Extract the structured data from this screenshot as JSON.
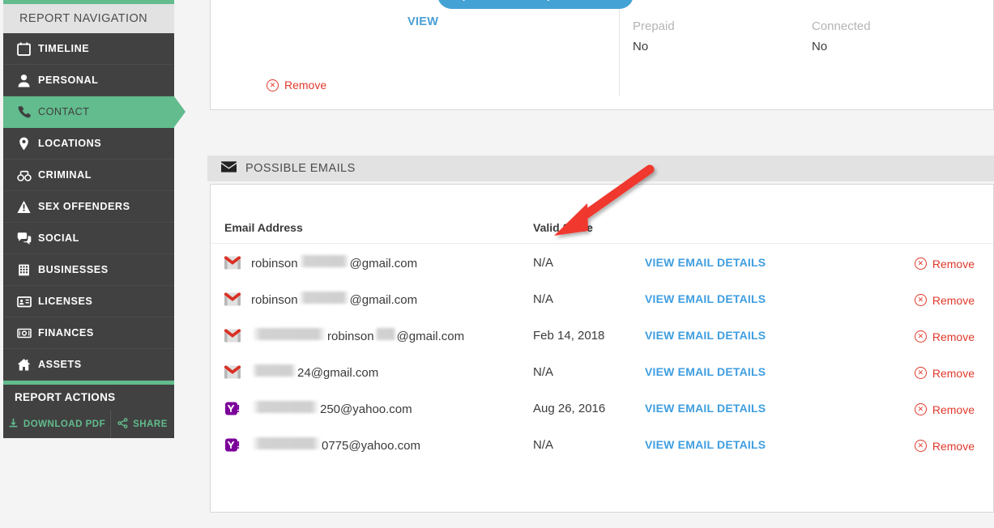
{
  "sidebar": {
    "header": "REPORT NAVIGATION",
    "items": [
      {
        "label": "TIMELINE",
        "icon": "calendar-icon",
        "active": false
      },
      {
        "label": "PERSONAL",
        "icon": "person-icon",
        "active": false
      },
      {
        "label": "CONTACT",
        "icon": "phone-icon",
        "active": true
      },
      {
        "label": "LOCATIONS",
        "icon": "map-pin-icon",
        "active": false
      },
      {
        "label": "CRIMINAL",
        "icon": "handcuffs-icon",
        "active": false
      },
      {
        "label": "SEX OFFENDERS",
        "icon": "warning-icon",
        "active": false
      },
      {
        "label": "SOCIAL",
        "icon": "chat-bubbles-icon",
        "active": false
      },
      {
        "label": "BUSINESSES",
        "icon": "building-icon",
        "active": false
      },
      {
        "label": "LICENSES",
        "icon": "id-card-icon",
        "active": false
      },
      {
        "label": "FINANCES",
        "icon": "banknote-icon",
        "active": false
      },
      {
        "label": "ASSETS",
        "icon": "house-icon",
        "active": false
      }
    ],
    "actions_header": "REPORT ACTIONS",
    "actions": [
      {
        "label": "DOWNLOAD PDF",
        "icon": "download-icon"
      },
      {
        "label": "SHARE",
        "icon": "share-icon"
      }
    ]
  },
  "top_panel": {
    "view_link": "VIEW",
    "tooltip": "Open or Close Report Sections",
    "fields": [
      {
        "label": "Prepaid",
        "value": "No"
      },
      {
        "label": "Connected",
        "value": "No"
      }
    ],
    "remove_label": "Remove"
  },
  "emails_section": {
    "header": "POSSIBLE EMAILS",
    "header_icon": "envelope-icon",
    "columns": {
      "email": "Email Address",
      "valid_since": "Valid Since",
      "details": "",
      "remove": ""
    },
    "details_label": "VIEW EMAIL DETAILS",
    "remove_label": "Remove",
    "rows": [
      {
        "provider": "gmail",
        "prefix": "robinson",
        "redact_w": 62,
        "middle": "",
        "redact2_w": 0,
        "suffix": "@gmail.com",
        "valid_since": "N/A"
      },
      {
        "provider": "gmail",
        "prefix": "robinson",
        "redact_w": 62,
        "middle": "",
        "redact2_w": 0,
        "suffix": "@gmail.com",
        "valid_since": "N/A"
      },
      {
        "provider": "gmail",
        "prefix": "",
        "redact_w": 92,
        "middle": "robinson",
        "redact2_w": 26,
        "suffix": "@gmail.com",
        "valid_since": "Feb 14, 2018"
      },
      {
        "provider": "gmail",
        "prefix": "",
        "redact_w": 55,
        "middle": "24",
        "redact2_w": 0,
        "suffix": "@gmail.com",
        "valid_since": "N/A"
      },
      {
        "provider": "yahoo",
        "prefix": "",
        "redact_w": 83,
        "middle": "250",
        "redact2_w": 0,
        "suffix": "@yahoo.com",
        "valid_since": "Aug 26, 2016"
      },
      {
        "provider": "yahoo",
        "prefix": "",
        "redact_w": 85,
        "middle": "0775",
        "redact2_w": 0,
        "suffix": "@yahoo.com",
        "valid_since": "N/A"
      }
    ]
  },
  "annotation": {
    "type": "red-arrow",
    "color": "#f0372e",
    "points_to": "Email Address column header"
  },
  "colors": {
    "accent_green": "#62bc8d",
    "sidebar_dark": "#414141",
    "link_blue": "#3f9ee0",
    "tooltip_blue": "#45a2d4",
    "danger_red": "#e0392c",
    "panel_gray": "#e2e2e2"
  }
}
